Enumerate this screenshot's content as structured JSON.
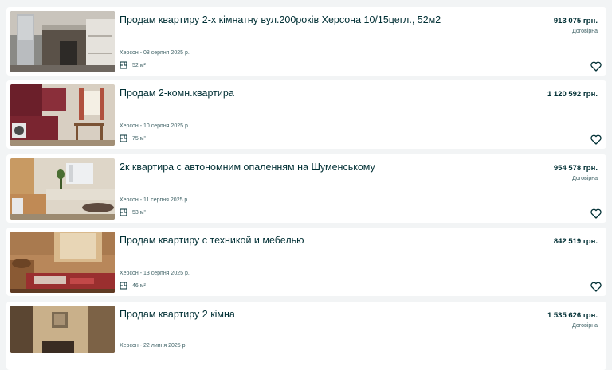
{
  "listings": [
    {
      "title": "Продам квартиру 2-х кімнатну вул.200років Херсона 10/15цегл., 52м2",
      "location_date": "Херсон - 08 серпня 2025 р.",
      "area": "52 м²",
      "price": "913 075 грн.",
      "negotiable": "Договірна",
      "favorite_icon": "heart-outline-icon"
    },
    {
      "title": "Продам 2-комн.квартира",
      "location_date": "Херсон - 10 серпня 2025 р.",
      "area": "75 м²",
      "price": "1 120 592 грн.",
      "negotiable": "",
      "favorite_icon": "heart-outline-icon"
    },
    {
      "title": "2к квартира с автономним опаленням на Шуменському",
      "location_date": "Херсон - 11 серпня 2025 р.",
      "area": "53 м²",
      "price": "954 578 грн.",
      "negotiable": "Договірна",
      "favorite_icon": "heart-outline-icon"
    },
    {
      "title": "Продам квартиру с техникой и мебелью",
      "location_date": "Херсон - 13 серпня 2025 р.",
      "area": "46 м²",
      "price": "842 519 грн.",
      "negotiable": "",
      "favorite_icon": "heart-outline-icon"
    },
    {
      "title": "Продам квартиру 2 кімна",
      "location_date": "Херсон - 22 липня 2025 р.",
      "area": "",
      "price": "1 535 626 грн.",
      "negotiable": "Договірна",
      "favorite_icon": "heart-outline-icon"
    }
  ],
  "colors": {
    "page_background": "#f2f4f5",
    "card_background": "#ffffff",
    "text_primary": "#002f34",
    "text_secondary": "#406367"
  }
}
